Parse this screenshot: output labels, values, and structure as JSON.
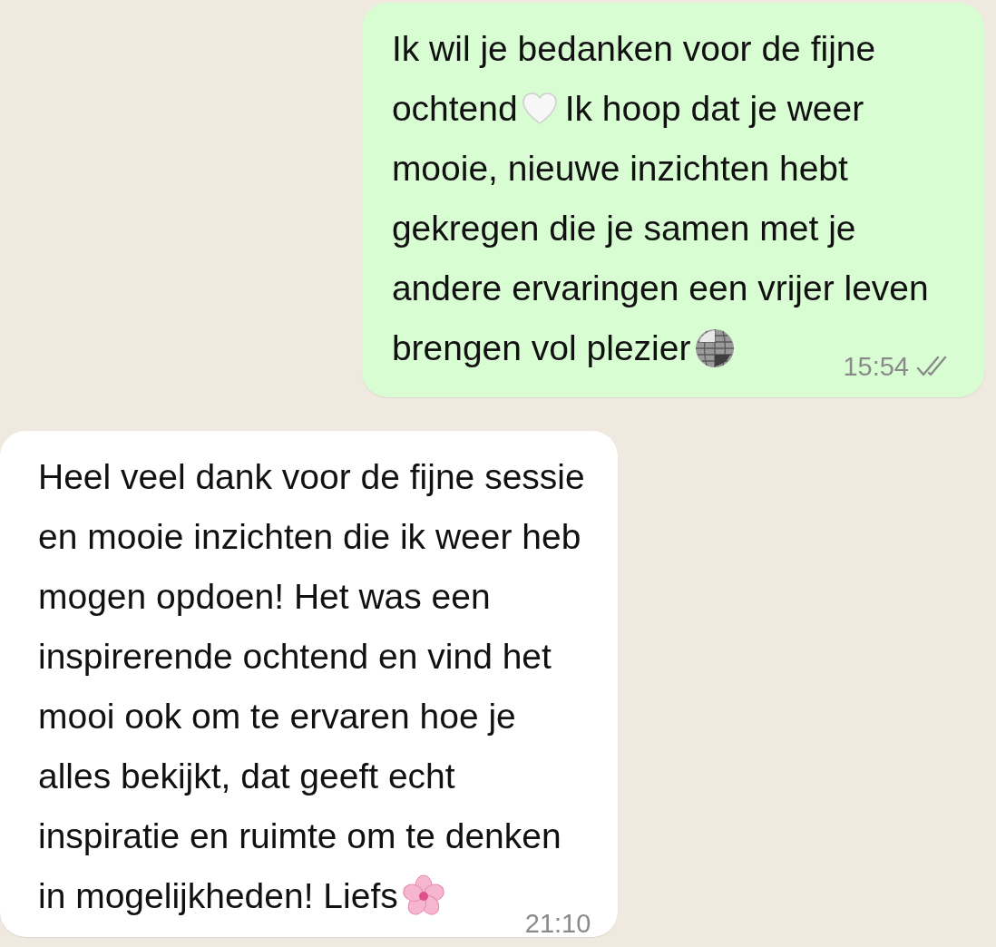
{
  "messages": [
    {
      "kind": "outgoing",
      "time": "15:54",
      "read": false,
      "lines": [
        [
          {
            "kind": "text",
            "text": "Ik wil je bedanken voor de fijne"
          }
        ],
        [
          {
            "kind": "text",
            "text": "ochtend"
          },
          {
            "kind": "heart"
          },
          {
            "kind": "text",
            "text": "Ik hoop dat je weer"
          }
        ],
        [
          {
            "kind": "text",
            "text": "mooie, nieuwe inzichten hebt"
          }
        ],
        [
          {
            "kind": "text",
            "text": "gekregen die je samen met je"
          }
        ],
        [
          {
            "kind": "text",
            "text": "andere ervaringen een vrijer leven"
          }
        ],
        [
          {
            "kind": "text",
            "text": "brengen vol plezier"
          },
          {
            "kind": "discoball"
          }
        ]
      ]
    },
    {
      "kind": "incoming",
      "time": "21:10",
      "lines": [
        [
          {
            "kind": "text",
            "text": "Heel veel dank voor de fijne sessie"
          }
        ],
        [
          {
            "kind": "text",
            "text": "en mooie inzichten die ik weer heb"
          }
        ],
        [
          {
            "kind": "text",
            "text": "mogen opdoen! Het was een"
          }
        ],
        [
          {
            "kind": "text",
            "text": "inspirerende ochtend en vind het"
          }
        ],
        [
          {
            "kind": "text",
            "text": "mooi ook om te ervaren hoe je"
          }
        ],
        [
          {
            "kind": "text",
            "text": "alles bekijkt, dat geeft echt"
          }
        ],
        [
          {
            "kind": "text",
            "text": "inspiratie en ruimte om te denken"
          }
        ],
        [
          {
            "kind": "text",
            "text": "in mogelijkheden! Liefs"
          },
          {
            "kind": "flower"
          }
        ]
      ]
    }
  ]
}
